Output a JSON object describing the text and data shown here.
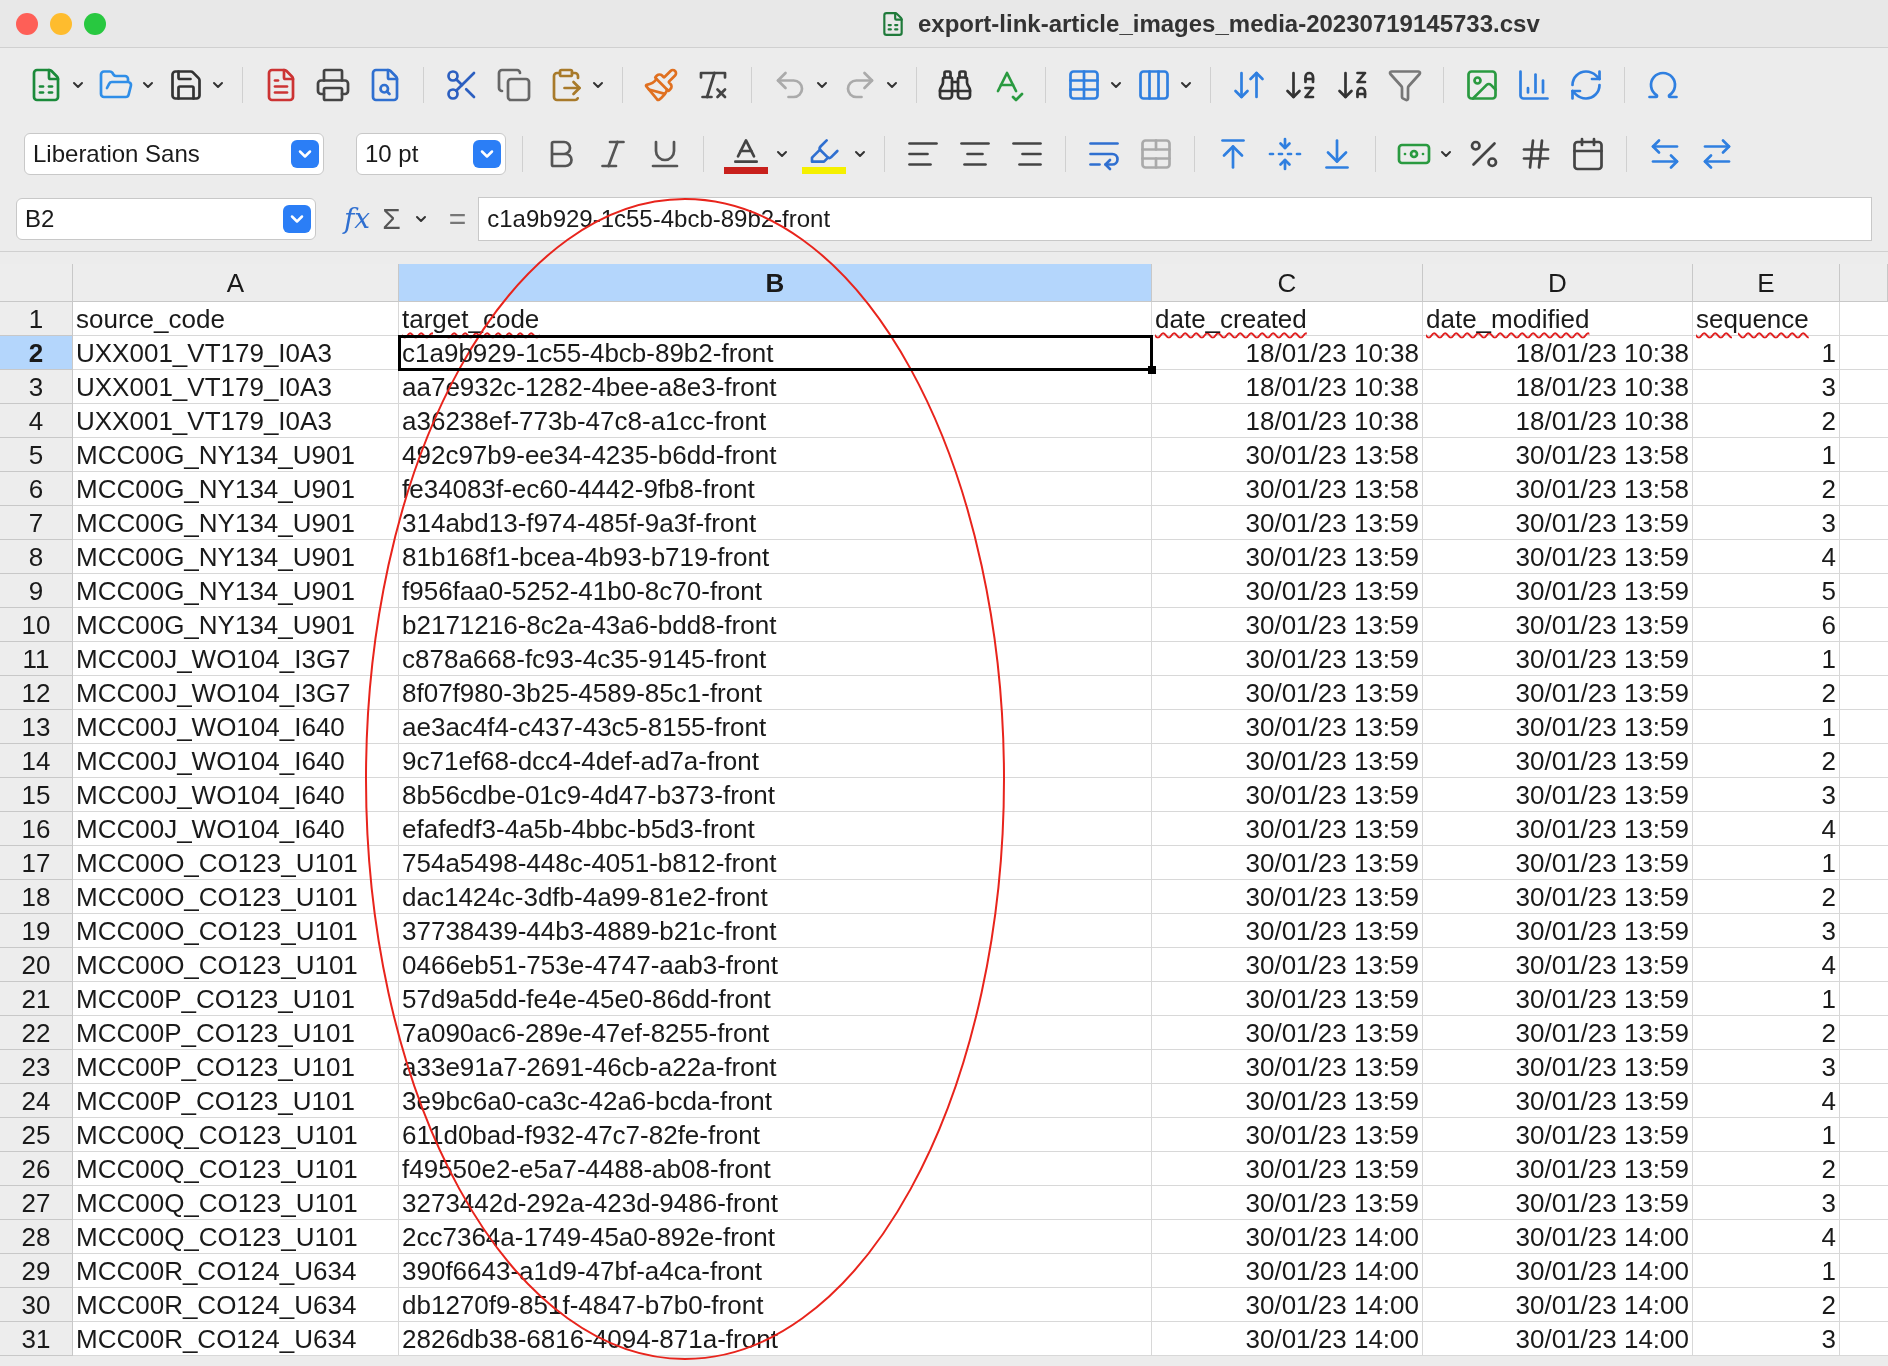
{
  "window": {
    "title": "export-link-article_images_media-20230719145733.csv"
  },
  "formatting": {
    "font": "Liberation Sans",
    "size": "10 pt"
  },
  "formula_bar": {
    "name_box": "B2",
    "function_wizard": "fx",
    "sum": "Σ",
    "equals": "=",
    "content": "c1a9b929-1c55-4bcb-89b2-front"
  },
  "columns": [
    {
      "label": "A",
      "selected": false,
      "kind": "text"
    },
    {
      "label": "B",
      "selected": true,
      "kind": "text"
    },
    {
      "label": "C",
      "selected": false,
      "kind": "number"
    },
    {
      "label": "D",
      "selected": false,
      "kind": "number"
    },
    {
      "label": "E",
      "selected": false,
      "kind": "number"
    }
  ],
  "rows": [
    {
      "number": "1",
      "selected": false,
      "kind": "header",
      "cells": [
        {
          "text": "source_code",
          "misspelled": false
        },
        {
          "text": "target_code",
          "misspelled": true
        },
        {
          "text": "date_created",
          "misspelled": true
        },
        {
          "text": "date_modified",
          "misspelled": true
        },
        {
          "text": "sequence",
          "misspelled": true
        }
      ]
    },
    {
      "number": "2",
      "selected": true,
      "kind": "data",
      "cells": [
        "UXX001_VT179_I0A3",
        "c1a9b929-1c55-4bcb-89b2-front",
        "18/01/23 10:38",
        "18/01/23 10:38",
        "1"
      ]
    },
    {
      "number": "3",
      "selected": false,
      "kind": "data",
      "cells": [
        "UXX001_VT179_I0A3",
        "aa7e932c-1282-4bee-a8e3-front",
        "18/01/23 10:38",
        "18/01/23 10:38",
        "3"
      ]
    },
    {
      "number": "4",
      "selected": false,
      "kind": "data",
      "cells": [
        "UXX001_VT179_I0A3",
        "a36238ef-773b-47c8-a1cc-front",
        "18/01/23 10:38",
        "18/01/23 10:38",
        "2"
      ]
    },
    {
      "number": "5",
      "selected": false,
      "kind": "data",
      "cells": [
        "MCC00G_NY134_U901",
        "492c97b9-ee34-4235-b6dd-front",
        "30/01/23 13:58",
        "30/01/23 13:58",
        "1"
      ]
    },
    {
      "number": "6",
      "selected": false,
      "kind": "data",
      "cells": [
        "MCC00G_NY134_U901",
        "fe34083f-ec60-4442-9fb8-front",
        "30/01/23 13:58",
        "30/01/23 13:58",
        "2"
      ]
    },
    {
      "number": "7",
      "selected": false,
      "kind": "data",
      "cells": [
        "MCC00G_NY134_U901",
        "314abd13-f974-485f-9a3f-front",
        "30/01/23 13:59",
        "30/01/23 13:59",
        "3"
      ]
    },
    {
      "number": "8",
      "selected": false,
      "kind": "data",
      "cells": [
        "MCC00G_NY134_U901",
        "81b168f1-bcea-4b93-b719-front",
        "30/01/23 13:59",
        "30/01/23 13:59",
        "4"
      ]
    },
    {
      "number": "9",
      "selected": false,
      "kind": "data",
      "cells": [
        "MCC00G_NY134_U901",
        "f956faa0-5252-41b0-8c70-front",
        "30/01/23 13:59",
        "30/01/23 13:59",
        "5"
      ]
    },
    {
      "number": "10",
      "selected": false,
      "kind": "data",
      "cells": [
        "MCC00G_NY134_U901",
        "b2171216-8c2a-43a6-bdd8-front",
        "30/01/23 13:59",
        "30/01/23 13:59",
        "6"
      ]
    },
    {
      "number": "11",
      "selected": false,
      "kind": "data",
      "cells": [
        "MCC00J_WO104_I3G7",
        "c878a668-fc93-4c35-9145-front",
        "30/01/23 13:59",
        "30/01/23 13:59",
        "1"
      ]
    },
    {
      "number": "12",
      "selected": false,
      "kind": "data",
      "cells": [
        "MCC00J_WO104_I3G7",
        "8f07f980-3b25-4589-85c1-front",
        "30/01/23 13:59",
        "30/01/23 13:59",
        "2"
      ]
    },
    {
      "number": "13",
      "selected": false,
      "kind": "data",
      "cells": [
        "MCC00J_WO104_I640",
        "ae3ac4f4-c437-43c5-8155-front",
        "30/01/23 13:59",
        "30/01/23 13:59",
        "1"
      ]
    },
    {
      "number": "14",
      "selected": false,
      "kind": "data",
      "cells": [
        "MCC00J_WO104_I640",
        "9c71ef68-dcc4-4def-ad7a-front",
        "30/01/23 13:59",
        "30/01/23 13:59",
        "2"
      ]
    },
    {
      "number": "15",
      "selected": false,
      "kind": "data",
      "cells": [
        "MCC00J_WO104_I640",
        "8b56cdbe-01c9-4d47-b373-front",
        "30/01/23 13:59",
        "30/01/23 13:59",
        "3"
      ]
    },
    {
      "number": "16",
      "selected": false,
      "kind": "data",
      "cells": [
        "MCC00J_WO104_I640",
        "efafedf3-4a5b-4bbc-b5d3-front",
        "30/01/23 13:59",
        "30/01/23 13:59",
        "4"
      ]
    },
    {
      "number": "17",
      "selected": false,
      "kind": "data",
      "cells": [
        "MCC00O_CO123_U101",
        "754a5498-448c-4051-b812-front",
        "30/01/23 13:59",
        "30/01/23 13:59",
        "1"
      ]
    },
    {
      "number": "18",
      "selected": false,
      "kind": "data",
      "cells": [
        "MCC00O_CO123_U101",
        "dac1424c-3dfb-4a99-81e2-front",
        "30/01/23 13:59",
        "30/01/23 13:59",
        "2"
      ]
    },
    {
      "number": "19",
      "selected": false,
      "kind": "data",
      "cells": [
        "MCC00O_CO123_U101",
        "37738439-44b3-4889-b21c-front",
        "30/01/23 13:59",
        "30/01/23 13:59",
        "3"
      ]
    },
    {
      "number": "20",
      "selected": false,
      "kind": "data",
      "cells": [
        "MCC00O_CO123_U101",
        "0466eb51-753e-4747-aab3-front",
        "30/01/23 13:59",
        "30/01/23 13:59",
        "4"
      ]
    },
    {
      "number": "21",
      "selected": false,
      "kind": "data",
      "cells": [
        "MCC00P_CO123_U101",
        "57d9a5dd-fe4e-45e0-86dd-front",
        "30/01/23 13:59",
        "30/01/23 13:59",
        "1"
      ]
    },
    {
      "number": "22",
      "selected": false,
      "kind": "data",
      "cells": [
        "MCC00P_CO123_U101",
        "7a090ac6-289e-47ef-8255-front",
        "30/01/23 13:59",
        "30/01/23 13:59",
        "2"
      ]
    },
    {
      "number": "23",
      "selected": false,
      "kind": "data",
      "cells": [
        "MCC00P_CO123_U101",
        "a33e91a7-2691-46cb-a22a-front",
        "30/01/23 13:59",
        "30/01/23 13:59",
        "3"
      ]
    },
    {
      "number": "24",
      "selected": false,
      "kind": "data",
      "cells": [
        "MCC00P_CO123_U101",
        "3e9bc6a0-ca3c-42a6-bcda-front",
        "30/01/23 13:59",
        "30/01/23 13:59",
        "4"
      ]
    },
    {
      "number": "25",
      "selected": false,
      "kind": "data",
      "cells": [
        "MCC00Q_CO123_U101",
        "611d0bad-f932-47c7-82fe-front",
        "30/01/23 13:59",
        "30/01/23 13:59",
        "1"
      ]
    },
    {
      "number": "26",
      "selected": false,
      "kind": "data",
      "cells": [
        "MCC00Q_CO123_U101",
        "f49550e2-e5a7-4488-ab08-front",
        "30/01/23 13:59",
        "30/01/23 13:59",
        "2"
      ]
    },
    {
      "number": "27",
      "selected": false,
      "kind": "data",
      "cells": [
        "MCC00Q_CO123_U101",
        "3273442d-292a-423d-9486-front",
        "30/01/23 13:59",
        "30/01/23 13:59",
        "3"
      ]
    },
    {
      "number": "28",
      "selected": false,
      "kind": "data",
      "cells": [
        "MCC00Q_CO123_U101",
        "2cc7364a-1749-45a0-892e-front",
        "30/01/23 14:00",
        "30/01/23 14:00",
        "4"
      ]
    },
    {
      "number": "29",
      "selected": false,
      "kind": "data",
      "cells": [
        "MCC00R_CO124_U634",
        "390f6643-a1d9-47bf-a4ca-front",
        "30/01/23 14:00",
        "30/01/23 14:00",
        "1"
      ]
    },
    {
      "number": "30",
      "selected": false,
      "kind": "data",
      "cells": [
        "MCC00R_CO124_U634",
        "db1270f9-851f-4847-b7b0-front",
        "30/01/23 14:00",
        "30/01/23 14:00",
        "2"
      ]
    },
    {
      "number": "31",
      "selected": false,
      "kind": "data",
      "cells": [
        "MCC00R_CO124_U634",
        "2826db38-6816-4094-871a-front",
        "30/01/23 14:00",
        "30/01/23 14:00",
        "3"
      ]
    }
  ]
}
